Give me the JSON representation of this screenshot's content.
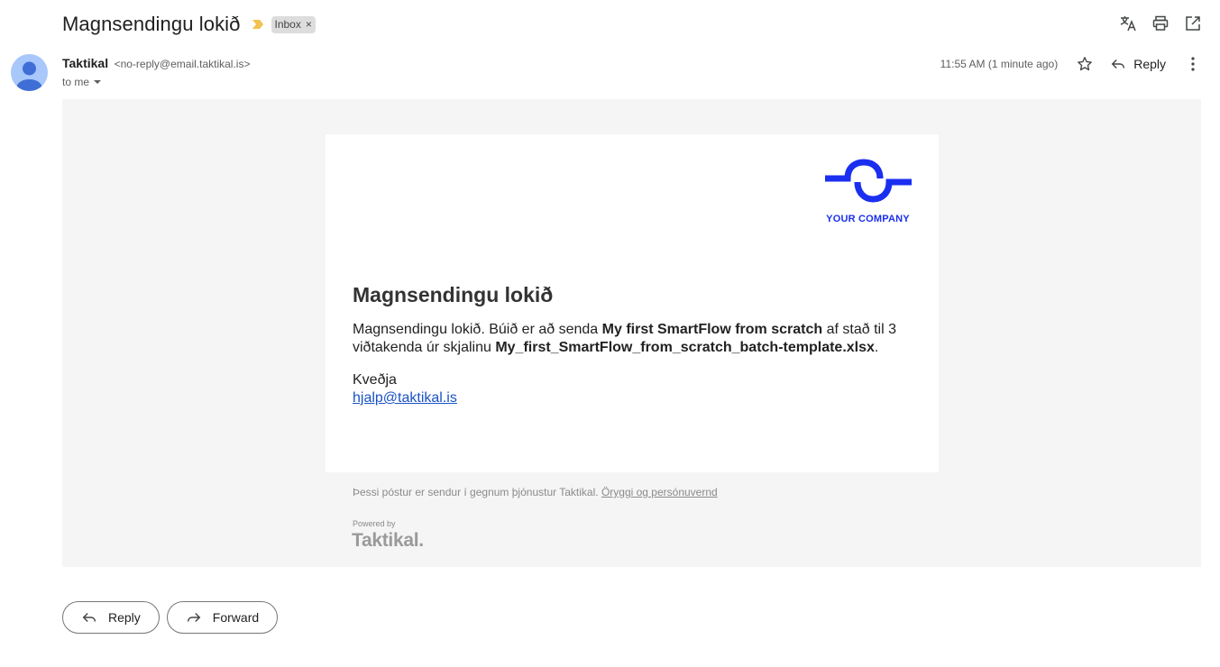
{
  "subject": "Magnsendingu lokið",
  "label": {
    "name": "Inbox",
    "remove": "×"
  },
  "sender": {
    "name": "Taktikal",
    "email": "<no-reply@email.taktikal.is>",
    "to": "to me"
  },
  "timestamp": "11:55 AM (1 minute ago)",
  "actions": {
    "reply": "Reply",
    "forward": "Forward"
  },
  "colors": {
    "brand": "#1b2ff0",
    "importance": "#f2c14e"
  },
  "email": {
    "logo_text": "YOUR COMPANY",
    "heading": "Magnsendingu lokið",
    "body_part1": "Magnsendingu lokið. Búið er að senda ",
    "flow_name": "My first SmartFlow from scratch",
    "body_part2": " af stað til 3 viðtakenda úr skjalinu ",
    "file_name": "My_first_SmartFlow_from_scratch_batch-template.xlsx",
    "body_part3": ".",
    "signoff": "Kveðja",
    "contact": "hjalp@taktikal.is"
  },
  "footer": {
    "note": "Þessi póstur er sendur í gegnum þjónustur Taktikal.",
    "link": "Öryggi og persónuvernd",
    "powered_by": "Powered by",
    "brand": "Taktikal."
  }
}
